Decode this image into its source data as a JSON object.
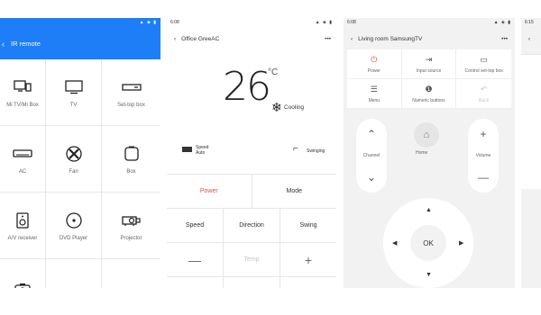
{
  "phone1": {
    "status_time": "",
    "status_icons": "▲ ◈ ▮",
    "title": "IR remote",
    "devices": [
      {
        "label": "Mi TV/Mi Box",
        "icon": "mi-tv-icon"
      },
      {
        "label": "TV",
        "icon": "tv-icon"
      },
      {
        "label": "Set-top box",
        "icon": "set-top-box-icon"
      },
      {
        "label": "AC",
        "icon": "ac-icon"
      },
      {
        "label": "Fan",
        "icon": "fan-icon"
      },
      {
        "label": "Box",
        "icon": "box-icon"
      },
      {
        "label": "A/V receiver",
        "icon": "av-receiver-icon"
      },
      {
        "label": "DVD Player",
        "icon": "dvd-player-icon"
      },
      {
        "label": "Projector",
        "icon": "projector-icon"
      },
      {
        "label": "",
        "icon": "camera-icon"
      }
    ]
  },
  "phone2": {
    "status_time": "6:08",
    "title": "Office GreeAC",
    "temperature": "26",
    "unit": "°C",
    "mode": "Cooling",
    "speed_label": "Speed",
    "speed_value": "Auto",
    "swing_label": "Swinging",
    "buttons": {
      "power": "Power",
      "mode": "Mode",
      "speed": "Speed",
      "direction": "Direction",
      "swing": "Swing",
      "minus": "—",
      "temp": "Temp",
      "plus": "+"
    }
  },
  "phone3": {
    "status_time": "6:08",
    "title": "Living room SamsungTV",
    "grid": [
      {
        "label": "Power",
        "icon": "power-icon",
        "glyph": "⏻"
      },
      {
        "label": "Input source",
        "icon": "input-source-icon",
        "glyph": "⇥"
      },
      {
        "label": "Control set-top box",
        "icon": "set-top-box-icon",
        "glyph": "▭"
      },
      {
        "label": "Menu",
        "icon": "menu-icon",
        "glyph": "☰"
      },
      {
        "label": "Numeric buttons",
        "icon": "numeric-icon",
        "glyph": "❶"
      },
      {
        "label": "Back",
        "icon": "back-icon",
        "glyph": "↶"
      }
    ],
    "channel_label": "Channel",
    "volume_label": "Volume",
    "home_label": "Home",
    "ok_label": "OK"
  },
  "phone4": {
    "status_time": "6:15"
  },
  "colors": {
    "accent": "#1e7ef7",
    "power_red": "#e74c3c"
  }
}
